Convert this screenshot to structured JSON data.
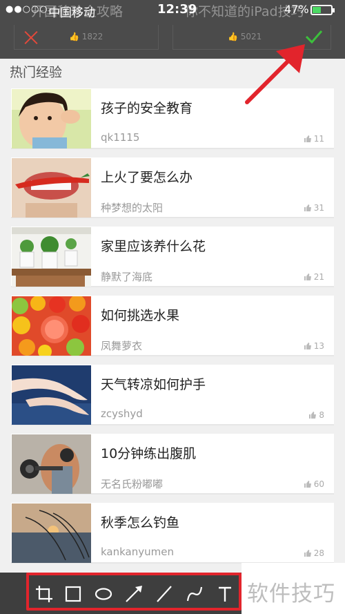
{
  "status_bar": {
    "signal": "●●○○○",
    "carrier": "中国移动",
    "time": "12:39",
    "battery_percent": "47%",
    "battery_level": 0.47,
    "battery_color": "#4cd964"
  },
  "background_cards": [
    {
      "title": "开国移珍全攻略",
      "likes": "1822"
    },
    {
      "title": "你不知道的iPad技巧",
      "likes": "5021"
    }
  ],
  "edit_bar": {
    "cancel_icon": "close-icon",
    "confirm_icon": "check-icon",
    "cancel_color": "#e5483a",
    "confirm_color": "#3cc03c"
  },
  "section": {
    "title": "热门经验"
  },
  "items": [
    {
      "title": "孩子的安全教育",
      "author": "qk1115",
      "likes": "11",
      "thumb": "child"
    },
    {
      "title": "上火了要怎么办",
      "author": "种梦想的太阳",
      "likes": "31",
      "thumb": "chili"
    },
    {
      "title": "家里应该养什么花",
      "author": "静默了海底",
      "likes": "21",
      "thumb": "plants"
    },
    {
      "title": "如何挑选水果",
      "author": "凤舞萝衣",
      "likes": "13",
      "thumb": "fruit"
    },
    {
      "title": "天气转凉如何护手",
      "author": "zcyshyd",
      "likes": "8",
      "thumb": "hands"
    },
    {
      "title": "10分钟练出腹肌",
      "author": "无名氏粉嘟嘟",
      "likes": "60",
      "thumb": "fitness"
    },
    {
      "title": "秋季怎么钓鱼",
      "author": "kankanyumen",
      "likes": "28",
      "thumb": "fishing"
    }
  ],
  "toolbar": {
    "tools": [
      "crop-icon",
      "rectangle-icon",
      "ellipse-icon",
      "arrow-icon",
      "line-icon",
      "curve-icon",
      "text-icon"
    ],
    "highlight_color": "#e2242c"
  },
  "annotation_arrow_color": "#e2242c",
  "watermark": "软件技巧"
}
